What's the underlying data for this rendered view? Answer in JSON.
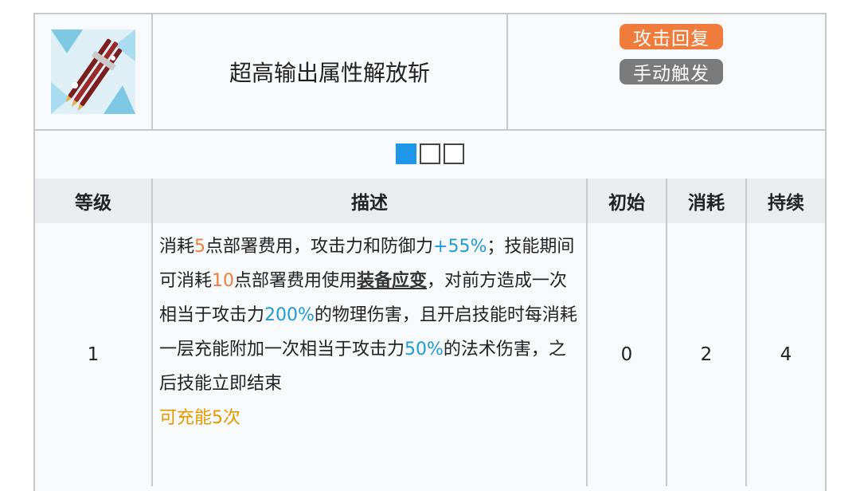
{
  "skill": {
    "name": "超高输出属性解放斩",
    "icon": "skill-icon",
    "tags": [
      {
        "label": "攻击回复",
        "color": "#f07c3c"
      },
      {
        "label": "手动触发",
        "color": "#7a7a7a"
      }
    ]
  },
  "level_selector": {
    "count": 3,
    "active_index": 0,
    "active_color": "#1f97e8"
  },
  "table": {
    "headers": {
      "level": "等级",
      "desc": "描述",
      "init": "初始",
      "cost": "消耗",
      "duration": "持续"
    },
    "row": {
      "level": "1",
      "desc": {
        "p1": "消耗",
        "v1": "5",
        "p2": "点部署费用，攻击力和防御力",
        "v2": "+55%",
        "p3": "；技能期间可消耗",
        "v3": "10",
        "p4": "点部署费用使用",
        "term": "装备应变",
        "p5": "，对前方造成一次相当于攻击力",
        "v4": "200%",
        "p6": "的物理伤害，且开启技能时每消耗一层充能附加一次相当于攻击力",
        "v5": "50%",
        "p7": "的法术伤害，之后技能立即结束",
        "charge": "可充能5次"
      },
      "init": "0",
      "cost": "2",
      "duration": "4"
    }
  }
}
